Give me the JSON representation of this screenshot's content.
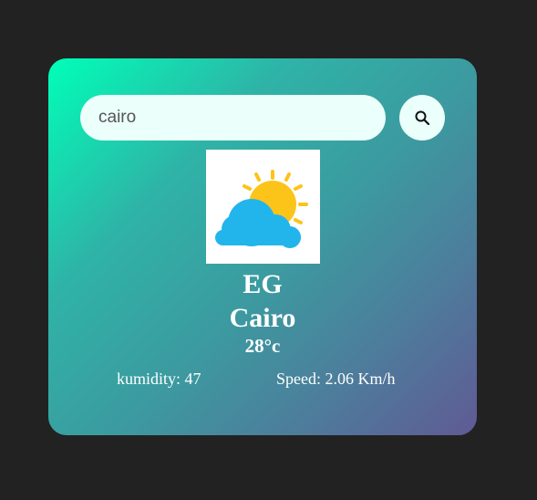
{
  "search": {
    "value": "cairo",
    "button_icon": "search-icon"
  },
  "weather": {
    "icon": "partly-cloudy-icon",
    "country": "EG",
    "city": "Cairo",
    "temperature": "28°c",
    "humidity_label": "kumidity: 47",
    "speed_label": "Speed: 2.06 Km/h"
  },
  "colors": {
    "background": "#222222",
    "card_gradient_start": "#00ffb8",
    "card_gradient_end": "#5f5a94",
    "input_background": "#ebfffb",
    "sun": "#fcc419",
    "cloud": "#22b5ec"
  }
}
